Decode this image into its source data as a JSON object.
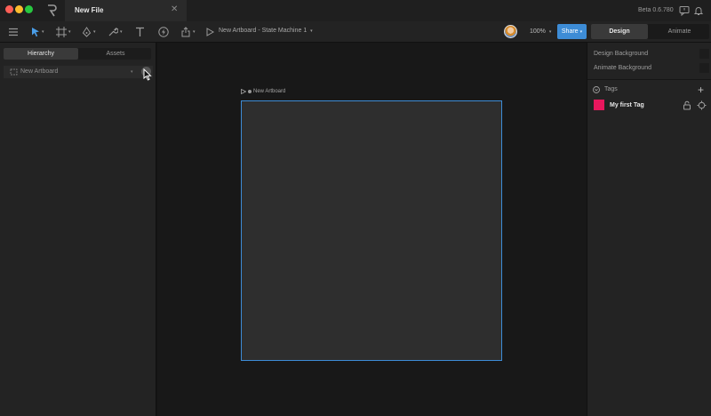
{
  "titlebar": {
    "tab_label": "New File",
    "tab_close": "✕",
    "version": "Beta 0.6.780"
  },
  "toolbar": {
    "artboard_title": "New Artboard - State Machine 1",
    "zoom": "100%",
    "share_label": "Share",
    "mode_design": "Design",
    "mode_animate": "Animate",
    "caret": "▾"
  },
  "left_panel": {
    "tab_hierarchy": "Hierarchy",
    "tab_assets": "Assets",
    "row_label": "New Artboard",
    "row_caret": "▾"
  },
  "stage": {
    "artboard_label": "New Artboard"
  },
  "right_panel": {
    "design_background": "Design Background",
    "animate_background": "Animate Background",
    "tags_header": "Tags",
    "tags_add": "+",
    "tags": [
      {
        "name": "My first Tag",
        "color": "#e8175d"
      }
    ]
  },
  "colors": {
    "accent": "#3d8cd6",
    "tag": "#e8175d"
  }
}
